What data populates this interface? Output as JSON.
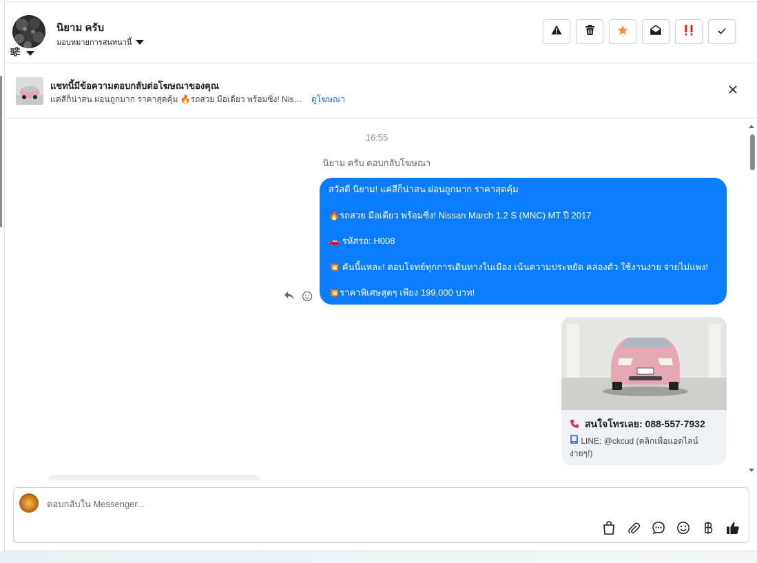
{
  "header": {
    "contact_name": "นิยาม ครับ",
    "assign_label": "มอบหมายการสนทนานี้",
    "actions": [
      {
        "icon": "warning-icon"
      },
      {
        "icon": "trash-icon"
      },
      {
        "icon": "star-icon",
        "color": "#f7923a"
      },
      {
        "icon": "mark-unread-icon"
      },
      {
        "icon": "important-icon",
        "color": "#e02020"
      },
      {
        "icon": "check-icon"
      }
    ]
  },
  "banner": {
    "title": "แชทนี้มีข้อความตอบกลับต่อโฆษณาของคุณ",
    "subtitle": "แค่สีก็น่าสน ผ่อนถูกมาก ราคาสุดคุ้ม 🔥รถสวย มือเดียว พร้อมซิ่ง! Nissan ...",
    "link": "ดูโฆษณา"
  },
  "chat": {
    "timestamp": "16:55",
    "system_note": "นิยาม ครับ ตอบกลับโฆษณา",
    "message_lines": [
      "สวัสดี นิยาม! แค่สีก็น่าสน ผ่อนถูกมาก ราคาสุดคุ้ม",
      "🔥รถสวย มือเดียว พร้อมซิ่ง! Nissan March 1.2 S (MNC) MT ปี 2017",
      "🚗 รหัสรถ: H008",
      "💥 คันนี้แหละ! ตอบโจทย์ทุกการเดินทางในเมือง เน้นความประหยัด คล่องตัว ใช้งานง่าย จ่ายไม่แพง!",
      "💥ราคาพิเศษสุดๆ เพียง 199,000 บาท!"
    ],
    "card": {
      "phone_text": "สนใจโทรเลย: 088-557-7932",
      "line_text": "LINE: @ckcud (คลิกเพื่อแอดไลน์ง่ายๆ!)"
    }
  },
  "composer": {
    "placeholder": "ตอบกลับใน Messenger...",
    "tools": [
      "shopping-bag-icon",
      "attachment-icon",
      "chat-bubble-icon",
      "emoji-icon",
      "baht-icon",
      "thumbs-up-icon"
    ]
  },
  "colors": {
    "bubble": "#0a7cff",
    "link": "#216fdb"
  }
}
